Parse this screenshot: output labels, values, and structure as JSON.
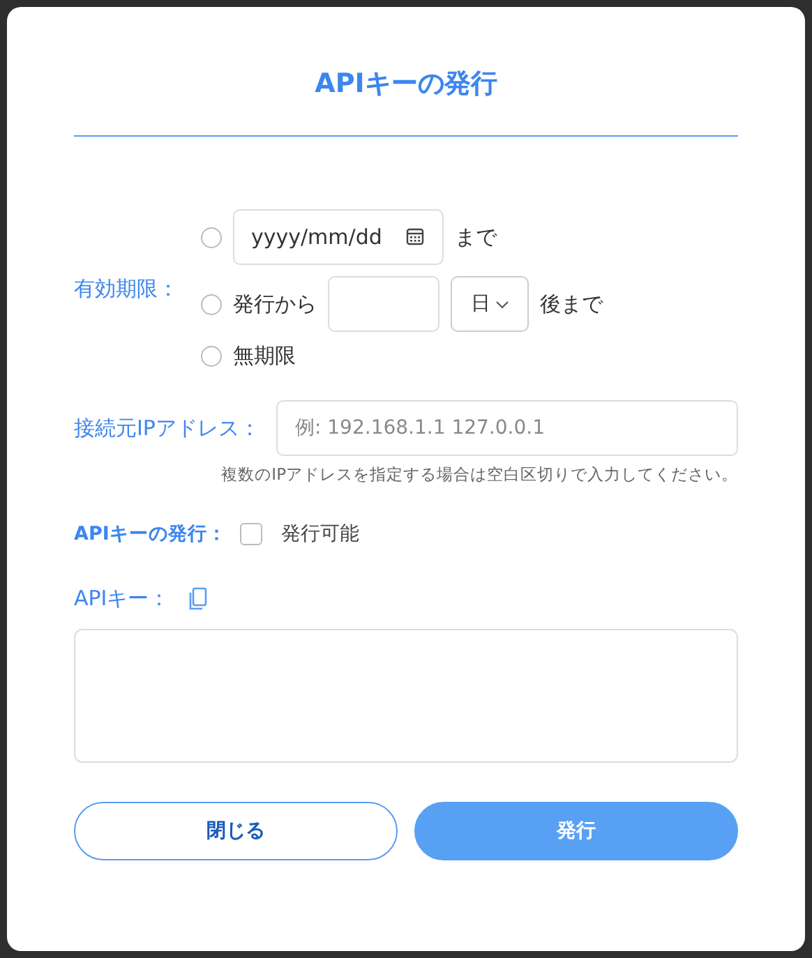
{
  "dialog": {
    "title": "APIキーの発行"
  },
  "expiry": {
    "label": "有効期限：",
    "options": [
      {
        "kind": "date",
        "selected": false,
        "placeholder": "yyyy/mm/dd",
        "suffix": "まで"
      },
      {
        "kind": "relative",
        "selected": false,
        "prefix": "発行から",
        "unit": "日",
        "suffix": "後まで"
      },
      {
        "kind": "plain",
        "selected": false,
        "label": "無期限"
      }
    ]
  },
  "ip": {
    "label": "接続元IPアドレス：",
    "placeholder": "例: 192.168.1.1 127.0.0.1",
    "hint": "複数のIPアドレスを指定する場合は空白区切りで入力してください。"
  },
  "issue": {
    "label": "APIキーの発行：",
    "checkbox": {
      "label": "発行可能",
      "checked": false
    }
  },
  "api_key": {
    "label": "APIキー："
  },
  "buttons": [
    {
      "label": "閉じる",
      "kind": "secondary"
    },
    {
      "label": "発行",
      "kind": "primary"
    }
  ]
}
